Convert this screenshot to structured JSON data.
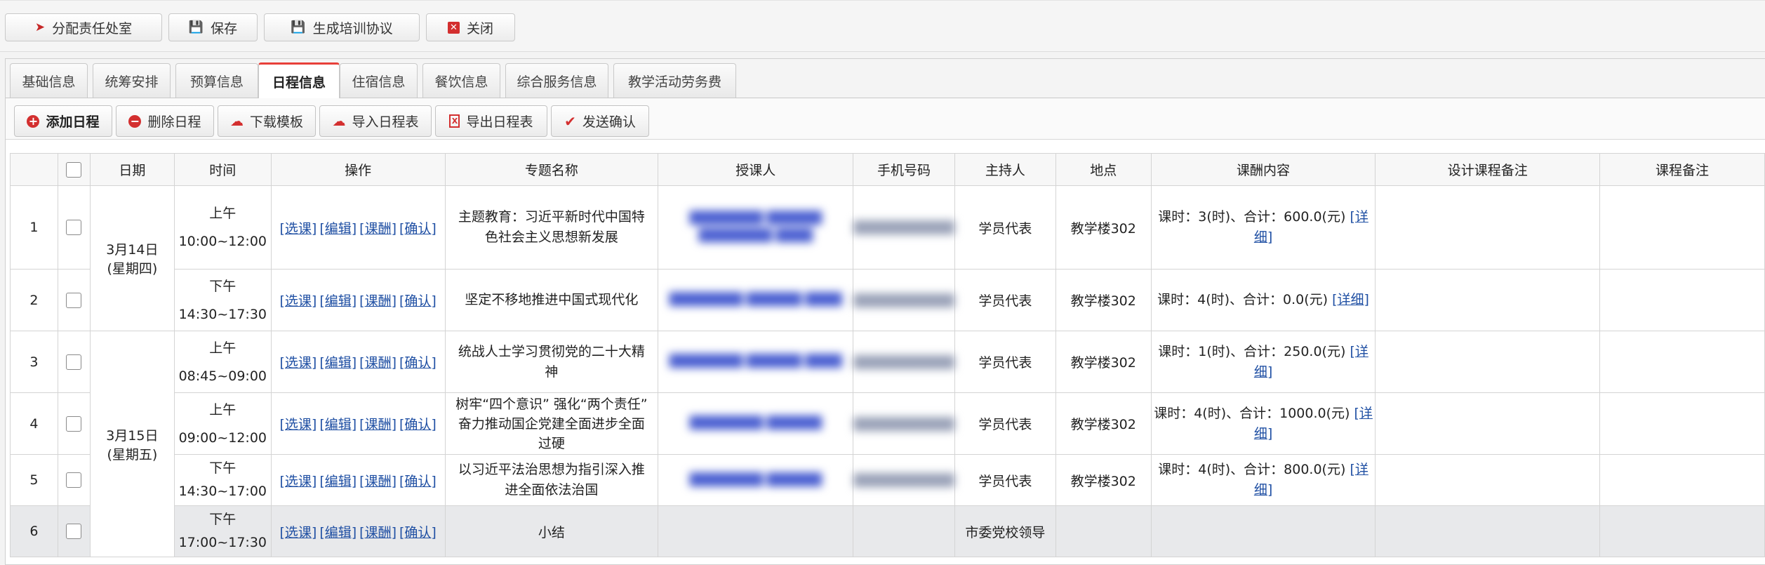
{
  "top_toolbar": {
    "assign": "分配责任处室",
    "save": "保存",
    "gen_agreement": "生成培训协议",
    "close": "关闭"
  },
  "tabs": [
    "基础信息",
    "统筹安排",
    "预算信息",
    "日程信息",
    "住宿信息",
    "餐饮信息",
    "综合服务信息",
    "教学活动劳务费"
  ],
  "active_tab": "日程信息",
  "actions": {
    "add": "添加日程",
    "delete": "删除日程",
    "download_template": "下载模板",
    "import": "导入日程表",
    "export": "导出日程表",
    "send_confirm": "发送确认"
  },
  "columns": [
    "日期",
    "时间",
    "操作",
    "专题名称",
    "授课人",
    "手机号码",
    "主持人",
    "地点",
    "课酬内容",
    "设计课程备注",
    "课程备注"
  ],
  "ops": [
    "[选课]",
    "[编辑]",
    "[课酬]",
    "[确认]"
  ],
  "detail_link": "[详细]",
  "dates": [
    {
      "date": "3月14日",
      "weekday": "(星期四)"
    },
    {
      "date": "3月15日",
      "weekday": "(星期五)"
    }
  ],
  "rows": [
    {
      "no": "1",
      "ampm": "上午",
      "time": "10:00~12:00",
      "topic": "主题教育：习近平新时代中国特色社会主义思想新发展",
      "teacher": "████████ ██████ ████████ ████",
      "phone": "███████████",
      "host": "学员代表",
      "place": "教学楼302",
      "fee": "课时：3(时)、合计：600.0(元)"
    },
    {
      "no": "2",
      "ampm": "下午",
      "time": "14:30~17:30",
      "topic": "坚定不移地推进中国式现代化",
      "teacher": "████████ ██████ ████",
      "phone": "███████████",
      "host": "学员代表",
      "place": "教学楼302",
      "fee": "课时：4(时)、合计：0.0(元)"
    },
    {
      "no": "3",
      "ampm": "上午",
      "time": "08:45~09:00",
      "topic": "统战人士学习贯彻党的二十大精神",
      "teacher": "████████ ██████ ████",
      "phone": "███████████",
      "host": "学员代表",
      "place": "教学楼302",
      "fee": "课时：1(时)、合计：250.0(元)"
    },
    {
      "no": "4",
      "ampm": "上午",
      "time": "09:00~12:00",
      "topic": "树牢“四个意识” 强化“两个责任” 奋力推动国企党建全面进步全面过硬",
      "teacher": "████████ ██████",
      "phone": "███████████",
      "host": "学员代表",
      "place": "教学楼302",
      "fee": "课时：4(时)、合计：1000.0(元)"
    },
    {
      "no": "5",
      "ampm": "下午",
      "time": "14:30~17:00",
      "topic": "以习近平法治思想为指引深入推进全面依法治国",
      "teacher": "████████ ██████",
      "phone": "███████████",
      "host": "学员代表",
      "place": "教学楼302",
      "fee": "课时：4(时)、合计：800.0(元)"
    },
    {
      "no": "6",
      "ampm": "下午",
      "time": "17:00~17:30",
      "topic": "小结",
      "teacher": "",
      "phone": "",
      "host": "市委党校领导",
      "place": "",
      "fee": ""
    }
  ]
}
